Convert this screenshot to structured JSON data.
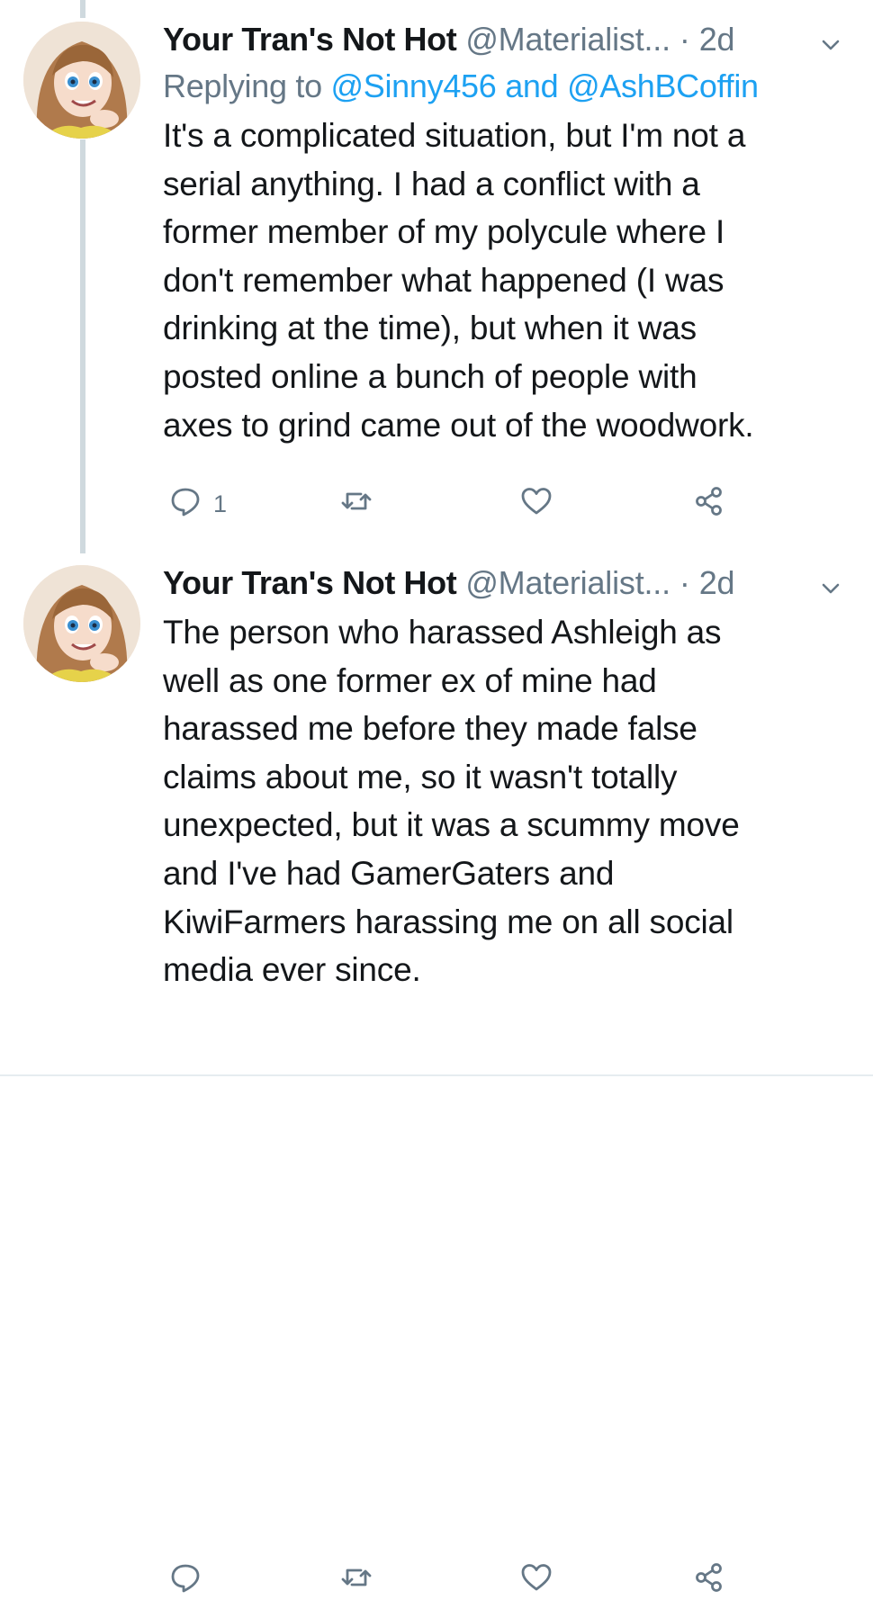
{
  "tweets": [
    {
      "name": "Your Tran's Not Hot",
      "handle": "@Materialist...",
      "separator": "·",
      "time": "2d",
      "reply_prefix": "Replying to",
      "reply_mention_1": "@Sinny456",
      "reply_and": "and",
      "reply_mention_2": "@AshBCoffin",
      "text": "It's a complicated situation, but I'm not a\nserial anything. I had a conflict with a\nformer member of my polycule where I\ndon't remember what happened (I was\ndrinking at the time), but when it was\nposted online a bunch of people with\naxes to grind came out of the woodwork.",
      "reply_count": "1"
    },
    {
      "name": "Your Tran's Not Hot",
      "handle": "@Materialist...",
      "separator": "·",
      "time": "2d",
      "text": "The person who harassed Ashleigh as\nwell as one former ex of mine had\nharassed me before they made false\nclaims about me, so it wasn't totally\nunexpected, but it was a scummy move\nand I've had GamerGaters and\nKiwiFarmers harassing me on all social\nmedia ever since.",
      "reply_count": ""
    }
  ],
  "icons": {
    "reply": "reply-icon",
    "retweet": "retweet-icon",
    "like": "heart-icon",
    "share": "share-icon",
    "menu": "chevron-down-icon"
  },
  "colors": {
    "text": "#14171a",
    "muted": "#657786",
    "link": "#1da1f2",
    "thread_line": "#cfd9de"
  }
}
